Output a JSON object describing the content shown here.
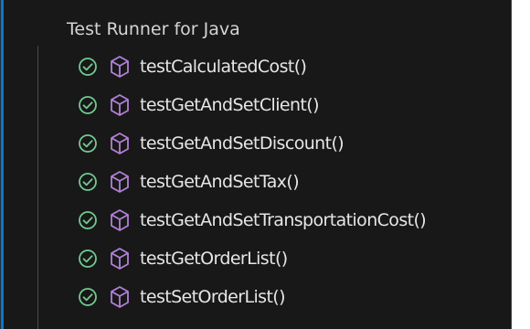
{
  "panel": {
    "title": "Test Runner for Java",
    "colors": {
      "background": "#181818",
      "pass": "#73c991",
      "method": "#b180d7",
      "text": "#e6e6e6"
    }
  },
  "tests": [
    {
      "name": "testCalculatedCost()",
      "status": "passed",
      "status_icon": "pass-circle-icon",
      "kind_icon": "method-cube-icon"
    },
    {
      "name": "testGetAndSetClient()",
      "status": "passed",
      "status_icon": "pass-circle-icon",
      "kind_icon": "method-cube-icon"
    },
    {
      "name": "testGetAndSetDiscount()",
      "status": "passed",
      "status_icon": "pass-circle-icon",
      "kind_icon": "method-cube-icon"
    },
    {
      "name": "testGetAndSetTax()",
      "status": "passed",
      "status_icon": "pass-circle-icon",
      "kind_icon": "method-cube-icon"
    },
    {
      "name": "testGetAndSetTransportationCost()",
      "status": "passed",
      "status_icon": "pass-circle-icon",
      "kind_icon": "method-cube-icon"
    },
    {
      "name": "testGetOrderList()",
      "status": "passed",
      "status_icon": "pass-circle-icon",
      "kind_icon": "method-cube-icon"
    },
    {
      "name": "testSetOrderList()",
      "status": "passed",
      "status_icon": "pass-circle-icon",
      "kind_icon": "method-cube-icon"
    }
  ]
}
